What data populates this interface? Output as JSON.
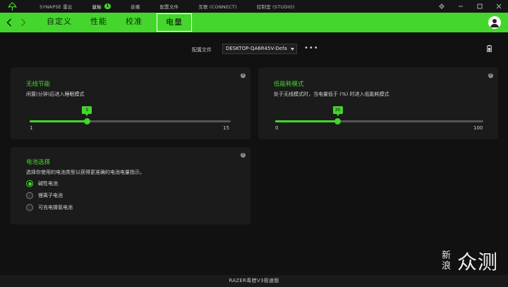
{
  "titlebar": {
    "tabs": [
      {
        "label": "SYNAPSE 雷云"
      },
      {
        "label": "鼠标",
        "badge": "1"
      },
      {
        "label": "音播"
      },
      {
        "label": "配置文件"
      },
      {
        "label": "互联 (CONNECT)"
      },
      {
        "label": "控制室 (STUDIO)"
      }
    ],
    "active_tab": "鼠标",
    "controls": [
      "gear-icon",
      "minimize-icon",
      "maximize-icon",
      "close-icon"
    ]
  },
  "nav": {
    "tabs": [
      {
        "label": "自定义"
      },
      {
        "label": "性能"
      },
      {
        "label": "校准"
      },
      {
        "label": "电量"
      }
    ],
    "active_tab": "电量"
  },
  "profile": {
    "label": "配置文件",
    "value": "DESKTOP-QA6R45V-Defa"
  },
  "wireless_power": {
    "title": "无线节能",
    "description": "闲置(分钟)后进入睡眠模式",
    "slider": {
      "min": "1",
      "max": "15",
      "value": "5",
      "fraction": 0.2857
    }
  },
  "low_power": {
    "title": "低能耗模式",
    "description": "处于无线模式时，当电量低于 (%) 时进入低能耗模式",
    "slider": {
      "min": "0",
      "max": "100",
      "value": "30",
      "fraction": 0.3
    }
  },
  "battery": {
    "title": "电池选择",
    "description": "选择你使用的电池类型以获得更准确的电池电量指示。",
    "options": [
      {
        "label": "碱性电池",
        "selected": true
      },
      {
        "label": "锂离子电池",
        "selected": false
      },
      {
        "label": "可充电镍氢电池",
        "selected": false
      }
    ]
  },
  "footer": {
    "device": "RAZER毒蝰V3极速版"
  },
  "watermark": {
    "line1": "新",
    "line2": "浪",
    "main": "众测"
  },
  "colors": {
    "accent": "#44d62c",
    "background": "#111111",
    "panel": "#1b1b1b"
  }
}
